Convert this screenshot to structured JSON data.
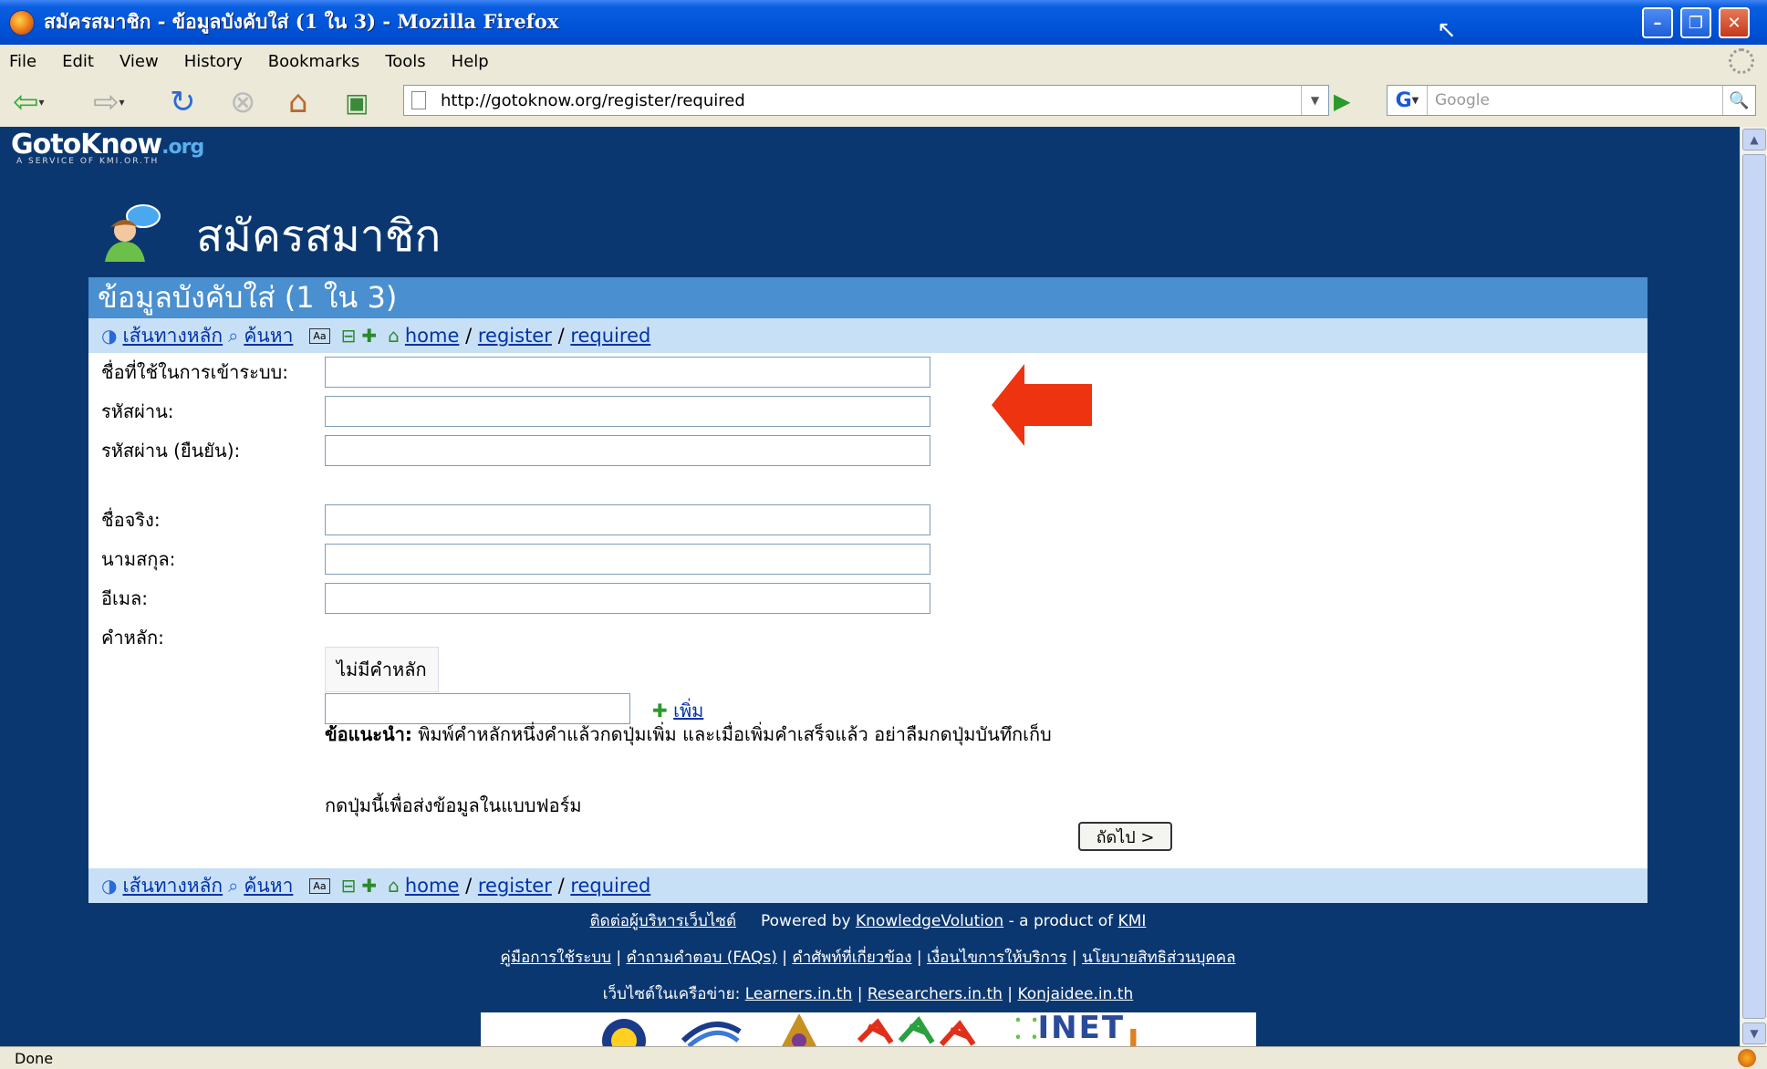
{
  "window": {
    "title": "สมัครสมาชิก - ข้อมูลบังคับใส่ (1 ใน 3) - Mozilla Firefox"
  },
  "menu": [
    "File",
    "Edit",
    "View",
    "History",
    "Bookmarks",
    "Tools",
    "Help"
  ],
  "address": {
    "url": "http://gotoknow.org/register/required"
  },
  "search": {
    "placeholder": "Google",
    "engine_label": "G"
  },
  "site": {
    "logo": "GotoKnow",
    "logo_suffix": ".org",
    "logo_tagline": "A SERVICE OF KMI.OR.TH"
  },
  "page": {
    "title": "สมัครสมาชิก",
    "subtitle": "ข้อมูลบังคับใส่ (1 ใน 3)"
  },
  "crumbs": {
    "main_route": "เส้นทางหลัก",
    "search": "ค้นหา",
    "font_icon_label": "Aa",
    "path": [
      "home",
      "register",
      "required"
    ],
    "separator": "/"
  },
  "form": {
    "username_label": "ชื่อที่ใช้ในการเข้าระบบ:",
    "password_label": "รหัสผ่าน:",
    "password_confirm_label": "รหัสผ่าน (ยืนยัน):",
    "firstname_label": "ชื่อจริง:",
    "lastname_label": "นามสกุล:",
    "email_label": "อีเมล:",
    "keywords_label": "คำหลัก:",
    "no_keywords": "ไม่มีคำหลัก",
    "add_label": "เพิ่ม",
    "hint_bold": "ข้อแนะนำ:",
    "hint_text": " พิมพ์คำหลักหนึ่งคำแล้วกดปุ่มเพิ่ม และเมื่อเพิ่มคำเสร็จแล้ว อย่าลืมกดปุ่มบันทึกเก็บ",
    "submit_text": "กดปุ่มนี้เพื่อส่งข้อมูลในแบบฟอร์ม",
    "next_button": "ถัดไป >"
  },
  "footer": {
    "contact": "ติดต่อผู้บริหารเว็บไซต์",
    "powered": "Powered by",
    "product": "KnowledgeVolution",
    "product_of": "- a product of",
    "org": "KMI",
    "links": [
      "คู่มือการใช้ระบบ",
      "คำถามคำตอบ (FAQs)",
      "คำศัพท์ที่เกี่ยวข้อง",
      "เงื่อนไขการให้บริการ",
      "นโยบายสิทธิส่วนบุคคล"
    ],
    "network_label": "เว็บไซต์ในเครือข่าย:",
    "network": [
      "Learners.in.th",
      "Researchers.in.th",
      "Konjaidee.in.th"
    ],
    "partner_inet": "INET"
  },
  "status": {
    "text": "Done"
  },
  "colors": {
    "site_navy": "#0b3770",
    "subhead_blue": "#4a8fd0",
    "crumb_bg": "#c8e0f6",
    "arrow_red": "#ee3311"
  }
}
